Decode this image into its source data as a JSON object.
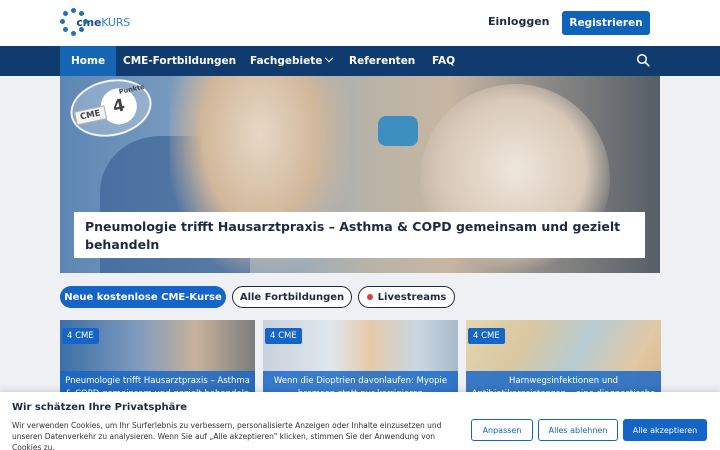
{
  "header": {
    "logo_text": "cme",
    "logo_accent": "KURS",
    "login_label": "Einloggen",
    "register_label": "Registrieren"
  },
  "nav": {
    "items": [
      {
        "label": "Home",
        "active": true
      },
      {
        "label": "CME-Fortbildungen"
      },
      {
        "label": "Fachgebiete",
        "has_dropdown": true
      },
      {
        "label": "Referenten"
      },
      {
        "label": "FAQ"
      }
    ],
    "search_icon": "search-icon"
  },
  "hero": {
    "badge_cme": "CME",
    "badge_number": "4",
    "badge_label": "Punkte",
    "title": "Pneumologie trifft Hausarztpraxis – Asthma & COPD gemeinsam und gezielt behandeln"
  },
  "filters": {
    "primary": "Neue kostenlose CME-Kurse",
    "all": "Alle Fortbildungen",
    "live": "Livestreams"
  },
  "cards": [
    {
      "tag": "4 CME",
      "title": "Pneumologie trifft Hausarztpraxis – Asthma & COPD gemeinsam und gezielt behandeln"
    },
    {
      "tag": "4 CME",
      "title": "Wenn die Dioptrien davonlaufen: Myopie bremsen statt nur korrigieren"
    },
    {
      "tag": "4 CME",
      "title": "Harnwegsinfektionen und Antibiotikaresistenzen – eine diagnostische"
    }
  ],
  "cookie": {
    "title": "Wir schätzen Ihre Privatsphäre",
    "text": "Wir verwenden Cookies, um Ihr Surferlebnis zu verbessern, personalisierte Anzeigen oder Inhalte einzusetzen und unseren Datenverkehr zu analysieren. Wenn Sie auf „Alle akzeptieren\" klicken, stimmen Sie der Anwendung von Cookies zu.",
    "customize_label": "Anpassen",
    "reject_label": "Alles ablehnen",
    "accept_label": "Alle akzeptieren"
  },
  "colors": {
    "nav_bg": "#0f3b6e",
    "accent": "#1565c8",
    "live_dot": "#e03a3a"
  }
}
